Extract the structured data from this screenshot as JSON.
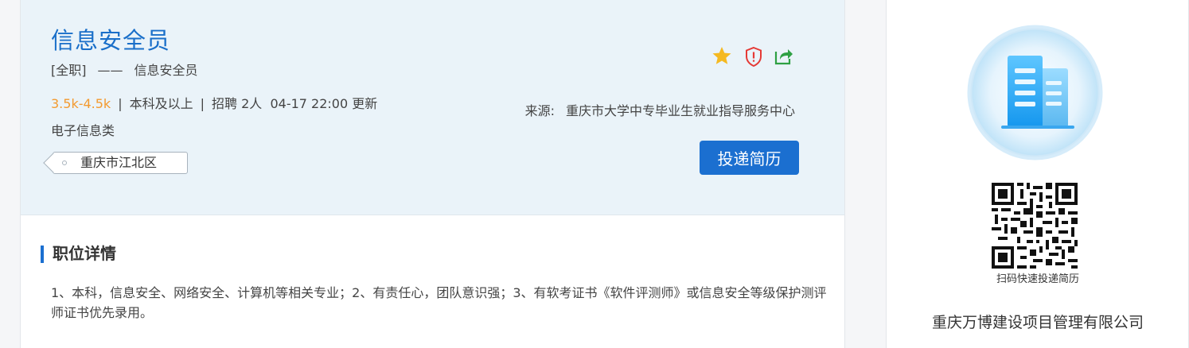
{
  "job": {
    "title": "信息安全员",
    "type_tag": "[全职]",
    "type_sep": "——",
    "type_name": "信息安全员",
    "salary": "3.5k-4.5k",
    "meta_sep": "|",
    "education": "本科及以上",
    "recruit": "招聘 2人",
    "updated": "04-17 22:00 更新",
    "category": "电子信息类",
    "location": "重庆市江北区",
    "source_label": "来源:",
    "source_value": "重庆市大学中专毕业生就业指导服务中心",
    "apply_label": "投递简历"
  },
  "actions": {
    "favorite_icon": "star-icon",
    "report_icon": "shield-alert-icon",
    "share_icon": "share-icon",
    "star_color": "#f5b921",
    "report_color": "#e53935",
    "share_color": "#2ea043"
  },
  "details": {
    "heading": "职位详情",
    "text": "1、本科，信息安全、网络安全、计算机等相关专业；2、有责任心，团队意识强；3、有软考证书《软件评测师》或信息安全等级保护测评师证书优先录用。"
  },
  "company": {
    "logo_icon": "building-icon",
    "qr_caption": "扫码快速投递简历",
    "name": "重庆万博建设项目管理有限公司"
  },
  "colors": {
    "accent": "#1b6fd0",
    "title": "#1a6fc9",
    "salary": "#f39a2f",
    "header_bg": "#eaf3f9"
  }
}
